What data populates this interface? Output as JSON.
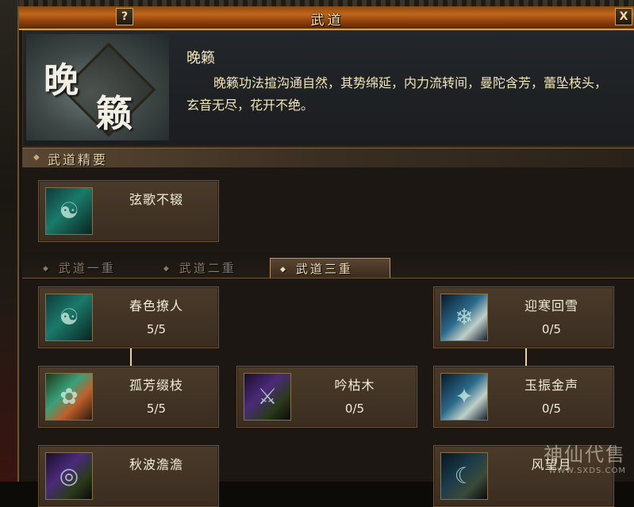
{
  "window": {
    "title": "武道",
    "help_label": "?",
    "close_label": "X"
  },
  "header": {
    "emblem_char_1": "晚",
    "emblem_char_2": "籁",
    "skill_name": "晚籁",
    "skill_description": "晚籁功法揎沟通自然，其势绵延，内力流转间，曼陀含芳，蕾坠枝头，玄音无尽，花开不绝。"
  },
  "essentials": {
    "title": "武道精要",
    "skill": {
      "name": "弦歌不辍",
      "icon": "jade-warrior-icon"
    }
  },
  "tabs": [
    {
      "label": "武道一重",
      "active": false
    },
    {
      "label": "武道二重",
      "active": false
    },
    {
      "label": "武道三重",
      "active": true
    }
  ],
  "tree": {
    "chunse": {
      "name": "春色撩人",
      "level": "5/5",
      "icon": "jade-warrior-icon"
    },
    "yinghan": {
      "name": "迎寒回雪",
      "level": "0/5",
      "icon": "snow-blade-icon"
    },
    "gufang": {
      "name": "孤芳缀枝",
      "level": "5/5",
      "icon": "flower-icon"
    },
    "yinkumu": {
      "name": "吟枯木",
      "level": "0/5",
      "icon": "withered-wood-icon"
    },
    "yuzhen": {
      "name": "玉振金声",
      "level": "0/5",
      "icon": "golden-sound-icon"
    },
    "qiubo": {
      "name": "秋波澹澹",
      "icon": "autumn-wave-icon"
    },
    "fengwang": {
      "name": "风望月",
      "icon": "moon-icon"
    }
  },
  "watermark": {
    "name": "神仙代售",
    "url": "WWW.SXDS.COM"
  }
}
